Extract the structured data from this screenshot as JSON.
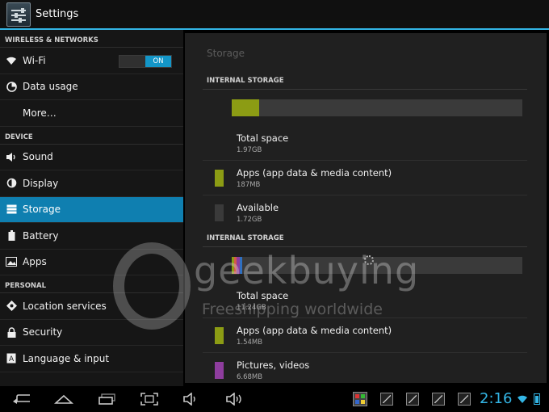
{
  "app": {
    "title": "Settings"
  },
  "sidebar": {
    "sections": [
      {
        "header": "WIRELESS & NETWORKS"
      },
      {
        "header": "DEVICE"
      },
      {
        "header": "PERSONAL"
      }
    ],
    "items": [
      {
        "label": "Wi-Fi",
        "icon": "wifi-icon",
        "toggle": "ON"
      },
      {
        "label": "Data usage",
        "icon": "data-usage-icon"
      },
      {
        "label": "More…",
        "icon": ""
      },
      {
        "label": "Sound",
        "icon": "sound-icon"
      },
      {
        "label": "Display",
        "icon": "display-icon"
      },
      {
        "label": "Storage",
        "icon": "storage-icon",
        "selected": true
      },
      {
        "label": "Battery",
        "icon": "battery-icon"
      },
      {
        "label": "Apps",
        "icon": "apps-icon"
      },
      {
        "label": "Location services",
        "icon": "location-icon"
      },
      {
        "label": "Security",
        "icon": "lock-icon"
      },
      {
        "label": "Language & input",
        "icon": "language-icon"
      }
    ]
  },
  "main": {
    "title": "Storage",
    "groups": [
      {
        "header": "INTERNAL STORAGE",
        "usage_fraction": 0.095,
        "rows": [
          {
            "title": "Total space",
            "value": "1.97GB",
            "color": ""
          },
          {
            "title": "Apps (app data & media content)",
            "value": "187MB",
            "color": "#8c9c14"
          },
          {
            "title": "Available",
            "value": "1.72GB",
            "color": "#3a3a3a"
          }
        ]
      },
      {
        "header": "INTERNAL STORAGE",
        "rows": [
          {
            "title": "Total space",
            "value": "11.24GB",
            "color": ""
          },
          {
            "title": "Apps (app data & media content)",
            "value": "1.54MB",
            "color": "#8c9c14"
          },
          {
            "title": "Pictures, videos",
            "value": "6.68MB",
            "color": "#8e3d9e"
          }
        ]
      }
    ]
  },
  "watermark": {
    "brand": "geekbuying",
    "tagline": "Freeshipping worldwide"
  },
  "statusbar": {
    "time": "2:16"
  },
  "colors": {
    "accent": "#33b5e5",
    "selected": "#0f7fb0",
    "apps": "#8c9c14",
    "pictures": "#8e3d9e"
  }
}
